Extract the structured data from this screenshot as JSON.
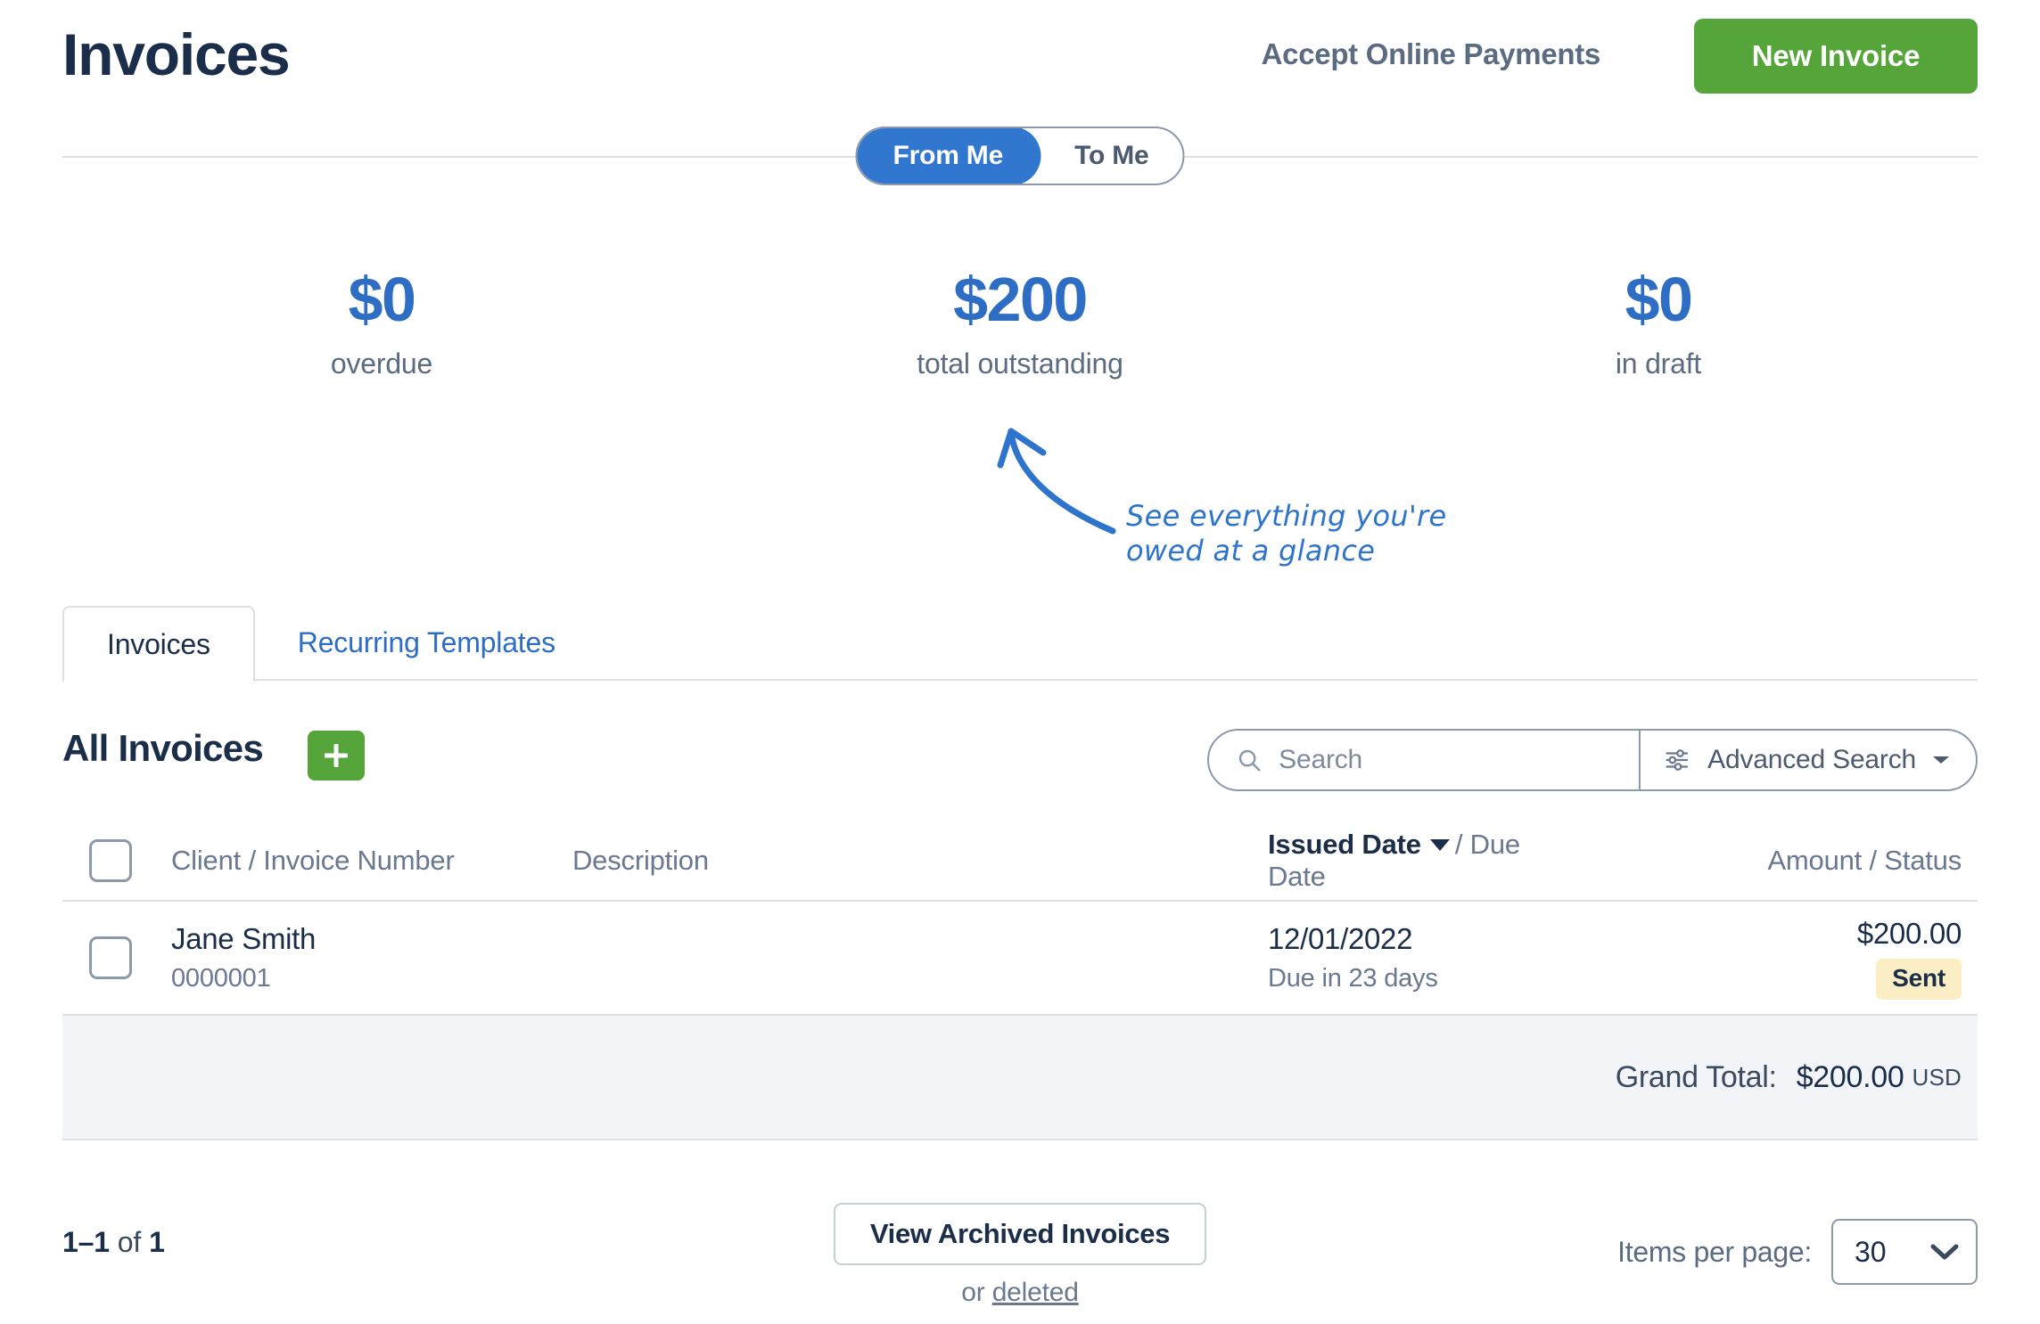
{
  "header": {
    "title": "Invoices",
    "accept_payments_label": "Accept Online Payments",
    "new_invoice_label": "New Invoice"
  },
  "toggle": {
    "options": [
      {
        "label": "From Me",
        "active": true
      },
      {
        "label": "To Me",
        "active": false
      }
    ]
  },
  "stats": [
    {
      "value": "$0",
      "label": "overdue"
    },
    {
      "value": "$200",
      "label": "total outstanding"
    },
    {
      "value": "$0",
      "label": "in draft"
    }
  ],
  "annotation": {
    "line1": "See everything you're",
    "line2": "owed at a glance",
    "color": "#2e74cc"
  },
  "tabs": [
    {
      "label": "Invoices",
      "active": true
    },
    {
      "label": "Recurring Templates",
      "active": false
    }
  ],
  "list_toolbar": {
    "title": "All Invoices",
    "add_label": "+"
  },
  "search": {
    "placeholder": "Search",
    "value": "",
    "advanced_label": "Advanced Search"
  },
  "table": {
    "columns": {
      "client": "Client / Invoice Number",
      "description": "Description",
      "date_sorted": "Issued Date",
      "date_rest": "/ Due Date",
      "amount": "Amount / Status"
    },
    "rows": [
      {
        "client": "Jane Smith",
        "invoice_number": "0000001",
        "description": "",
        "issued_date": "12/01/2022",
        "due_text": "Due in 23 days",
        "amount": "$200.00",
        "status": "Sent",
        "status_color": "#fceec4"
      }
    ],
    "grand_total_label": "Grand Total:",
    "grand_total_value": "$200.00",
    "grand_total_currency": "USD"
  },
  "footer": {
    "range": "1–1",
    "of": "of",
    "total": "1",
    "archived_label": "View Archived Invoices",
    "or_text": "or ",
    "deleted_label": "deleted",
    "items_per_page_label": "Items per page:",
    "items_per_page_value": "30"
  },
  "colors": {
    "brand_green": "#56a53a",
    "brand_blue": "#3177d0",
    "stat_blue": "#2d6dc4",
    "navy": "#1b2e49"
  }
}
